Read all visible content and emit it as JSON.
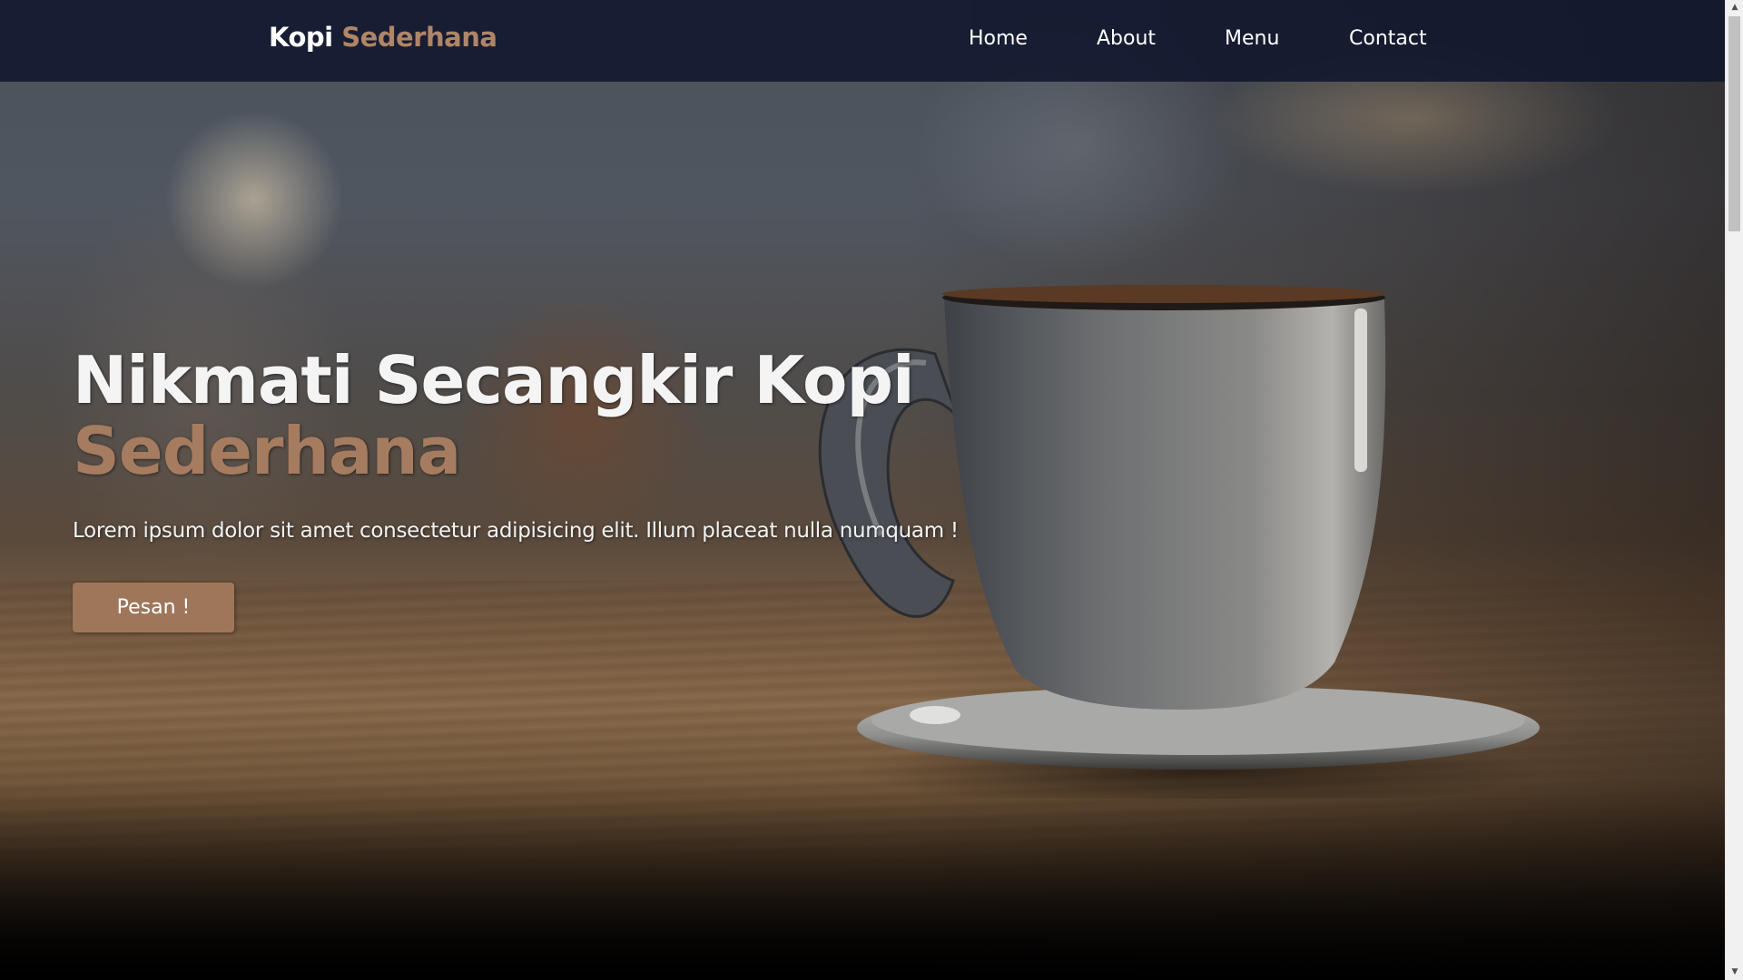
{
  "brand": {
    "name_primary": "Kopi",
    "name_accent": "Sederhana"
  },
  "nav": {
    "items": [
      {
        "label": "Home"
      },
      {
        "label": "About"
      },
      {
        "label": "Menu"
      },
      {
        "label": "Contact"
      }
    ]
  },
  "hero": {
    "title_main": "Nikmati Secangkir Kopi",
    "title_accent": "Sederhana",
    "description": "Lorem ipsum dolor sit amet consectetur adipisicing elit. Illum placeat nulla numquam !",
    "cta_label": "Pesan !",
    "background_icon": "coffee-cup-image"
  },
  "colors": {
    "navbar_bg": "#10162c",
    "accent": "#a57c5f",
    "cta_bg": "#9e765a",
    "text": "#ffffff"
  },
  "scrollbar": {
    "position_fraction": 0.0
  }
}
